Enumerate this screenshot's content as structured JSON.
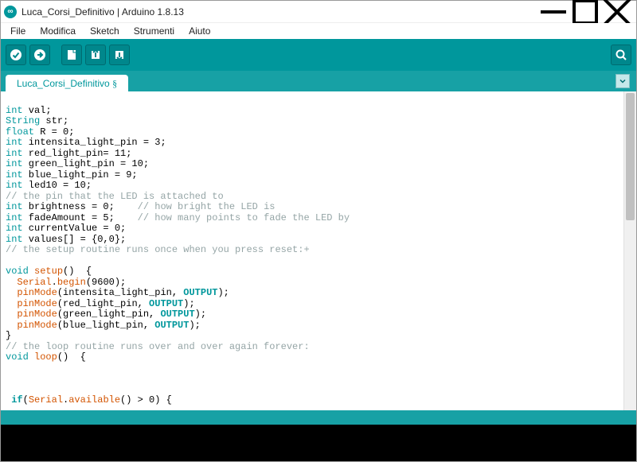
{
  "window": {
    "title": "Luca_Corsi_Definitivo | Arduino 1.8.13",
    "app_glyph": "∞"
  },
  "menubar": {
    "items": [
      "File",
      "Modifica",
      "Sketch",
      "Strumenti",
      "Aiuto"
    ]
  },
  "toolbar": {
    "verify": "verify",
    "upload": "upload",
    "new": "new",
    "open": "open",
    "save": "save",
    "monitor": "serial-monitor"
  },
  "tabs": {
    "active": "Luca_Corsi_Definitivo",
    "dirty_marker": "§"
  },
  "code": {
    "lines": [
      {
        "t": "",
        "cursor": true
      },
      {
        "t": "int val;",
        "tokens": [
          [
            "ty",
            "int"
          ],
          [
            "",
            " val;"
          ]
        ]
      },
      {
        "t": "String str;",
        "tokens": [
          [
            "ty",
            "String"
          ],
          [
            "",
            " str;"
          ]
        ]
      },
      {
        "t": "float R = 0;",
        "tokens": [
          [
            "ty",
            "float"
          ],
          [
            "",
            " R = 0;"
          ]
        ]
      },
      {
        "t": "int intensita_light_pin = 3;",
        "tokens": [
          [
            "ty",
            "int"
          ],
          [
            "",
            " intensita_light_pin = 3;"
          ]
        ]
      },
      {
        "t": "int red_light_pin= 11;",
        "tokens": [
          [
            "ty",
            "int"
          ],
          [
            "",
            " red_light_pin= 11;"
          ]
        ]
      },
      {
        "t": "int green_light_pin = 10;",
        "tokens": [
          [
            "ty",
            "int"
          ],
          [
            "",
            " green_light_pin = 10;"
          ]
        ]
      },
      {
        "t": "int blue_light_pin = 9;",
        "tokens": [
          [
            "ty",
            "int"
          ],
          [
            "",
            " blue_light_pin = 9;"
          ]
        ]
      },
      {
        "t": "int led10 = 10;",
        "tokens": [
          [
            "ty",
            "int"
          ],
          [
            "",
            " led10 = 10;"
          ]
        ]
      },
      {
        "t": "// the pin that the LED is attached to",
        "tokens": [
          [
            "cm",
            "// the pin that the LED is attached to"
          ]
        ]
      },
      {
        "t": "int brightness = 0;    // how bright the LED is",
        "tokens": [
          [
            "ty",
            "int"
          ],
          [
            "",
            " brightness = 0;    "
          ],
          [
            "cm",
            "// how bright the LED is"
          ]
        ]
      },
      {
        "t": "int fadeAmount = 5;    // how many points to fade the LED by",
        "tokens": [
          [
            "ty",
            "int"
          ],
          [
            "",
            " fadeAmount = 5;    "
          ],
          [
            "cm",
            "// how many points to fade the LED by"
          ]
        ]
      },
      {
        "t": "int currentValue = 0;",
        "tokens": [
          [
            "ty",
            "int"
          ],
          [
            "",
            " currentValue = 0;"
          ]
        ]
      },
      {
        "t": "int values[] = {0,0};",
        "tokens": [
          [
            "ty",
            "int"
          ],
          [
            "",
            " values[] = {0,0};"
          ]
        ]
      },
      {
        "t": "// the setup routine runs once when you press reset:+",
        "tokens": [
          [
            "cm",
            "// the setup routine runs once when you press reset:+"
          ]
        ]
      },
      {
        "t": ""
      },
      {
        "t": "void setup()  {",
        "tokens": [
          [
            "ty",
            "void"
          ],
          [
            "",
            " "
          ],
          [
            "fn",
            "setup"
          ],
          [
            "",
            "()  {"
          ]
        ]
      },
      {
        "t": "  Serial.begin(9600);",
        "tokens": [
          [
            "",
            "  "
          ],
          [
            "fn",
            "Serial"
          ],
          [
            "",
            "."
          ],
          [
            "fn",
            "begin"
          ],
          [
            "",
            "(9600);"
          ]
        ]
      },
      {
        "t": "  pinMode(intensita_light_pin, OUTPUT);",
        "tokens": [
          [
            "",
            "  "
          ],
          [
            "fn",
            "pinMode"
          ],
          [
            "",
            "(intensita_light_pin, "
          ],
          [
            "cn",
            "OUTPUT"
          ],
          [
            "",
            ");"
          ]
        ]
      },
      {
        "t": "  pinMode(red_light_pin, OUTPUT);",
        "tokens": [
          [
            "",
            "  "
          ],
          [
            "fn",
            "pinMode"
          ],
          [
            "",
            "(red_light_pin, "
          ],
          [
            "cn",
            "OUTPUT"
          ],
          [
            "",
            ");"
          ]
        ]
      },
      {
        "t": "  pinMode(green_light_pin, OUTPUT);",
        "tokens": [
          [
            "",
            "  "
          ],
          [
            "fn",
            "pinMode"
          ],
          [
            "",
            "(green_light_pin, "
          ],
          [
            "cn",
            "OUTPUT"
          ],
          [
            "",
            ");"
          ]
        ]
      },
      {
        "t": "  pinMode(blue_light_pin, OUTPUT);",
        "tokens": [
          [
            "",
            "  "
          ],
          [
            "fn",
            "pinMode"
          ],
          [
            "",
            "(blue_light_pin, "
          ],
          [
            "cn",
            "OUTPUT"
          ],
          [
            "",
            ");"
          ]
        ]
      },
      {
        "t": "}",
        "tokens": [
          [
            "",
            "}"
          ]
        ]
      },
      {
        "t": "// the loop routine runs over and over again forever:",
        "tokens": [
          [
            "cm",
            "// the loop routine runs over and over again forever:"
          ]
        ]
      },
      {
        "t": "void loop()  {",
        "tokens": [
          [
            "ty",
            "void"
          ],
          [
            "",
            " "
          ],
          [
            "fn",
            "loop"
          ],
          [
            "",
            "()  {"
          ]
        ]
      },
      {
        "t": ""
      },
      {
        "t": ""
      },
      {
        "t": ""
      },
      {
        "t": " if(Serial.available() > 0) {",
        "tokens": [
          [
            "",
            " "
          ],
          [
            "kw",
            "if"
          ],
          [
            "",
            "("
          ],
          [
            "fn",
            "Serial"
          ],
          [
            "",
            "."
          ],
          [
            "fn",
            "available"
          ],
          [
            "",
            "() > 0) {"
          ]
        ]
      }
    ]
  }
}
